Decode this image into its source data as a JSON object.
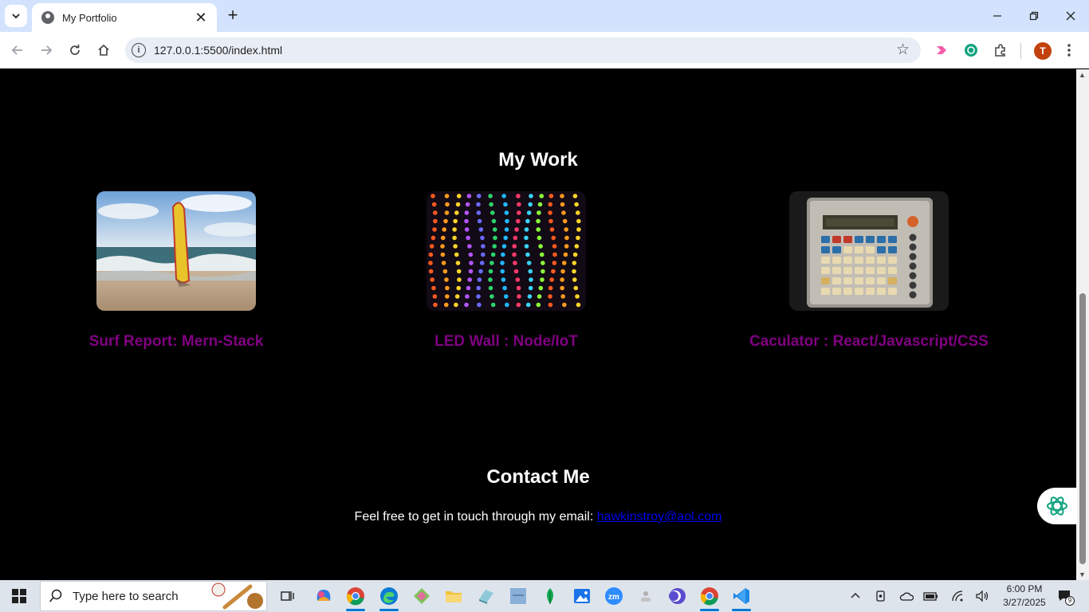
{
  "browser": {
    "tab_title": "My Portfolio",
    "tab_close": "✕",
    "new_tab": "+",
    "url": "127.0.0.1:5500/index.html",
    "profile_initial": "T"
  },
  "page": {
    "work_heading": "My Work",
    "projects": [
      {
        "title": "Surf Report: Mern-Stack",
        "image": "surfboard-beach-photo"
      },
      {
        "title": "LED Wall : Node/IoT",
        "image": "led-strips-photo"
      },
      {
        "title": "Caculator : React/Javascript/CSS",
        "image": "retro-calculator-photo"
      }
    ],
    "contact_heading": "Contact Me",
    "contact_text": "Feel free to get in touch through my email: ",
    "contact_email": "hawkinstroy@aol.com"
  },
  "taskbar": {
    "search_placeholder": "Type here to search",
    "time": "6:00 PM",
    "date": "3/27/2025",
    "notification_count": "9"
  },
  "colors": {
    "page_background": "#000000",
    "heading": "#ffffff",
    "project_title": "#800080",
    "link": "#0000ee"
  }
}
